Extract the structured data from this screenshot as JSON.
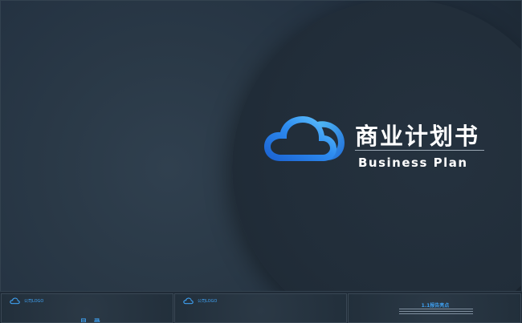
{
  "slide": {
    "title_cn": "商业计划书",
    "title_en": "Business Plan",
    "logo_icon": "cloud-icon"
  },
  "colors": {
    "accent": "#3fa0f0",
    "accent_light": "#6ed0ff",
    "accent_dark": "#1a5fd0",
    "background": "#243140",
    "text": "#ffffff"
  },
  "thumbnails": [
    {
      "logo_label": "公司LOGO",
      "toc_title": "目 录"
    },
    {
      "logo_label": "公司LOGO"
    },
    {
      "heading": "1.1报告亮点"
    }
  ]
}
